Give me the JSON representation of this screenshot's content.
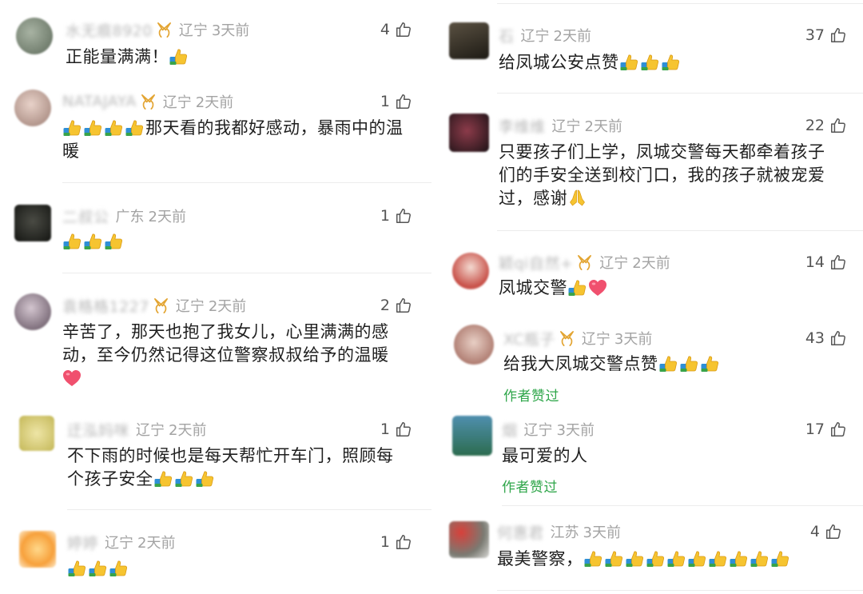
{
  "left": [
    {
      "user": "水无痕8920",
      "medal": true,
      "region": "辽宁",
      "time": "3天前",
      "likes": "4",
      "text": "正能量满满！",
      "emoji_after": 1,
      "avatar": "#7c8a78"
    },
    {
      "user": "NATAJAYA",
      "medal": true,
      "region": "辽宁",
      "time": "2天前",
      "likes": "1",
      "emoji_before": 4,
      "text_line1": "那天看的我都好感动，暴雨中的温",
      "text_line2": "暖",
      "avatar": "#b59a92"
    },
    {
      "user": "二叔公",
      "medal": false,
      "region": "广东",
      "time": "2天前",
      "likes": "1",
      "emoji_only": 3,
      "avatar": "#2e2f2a"
    },
    {
      "user": "袁格格1227",
      "medal": true,
      "region": "辽宁",
      "time": "2天前",
      "likes": "2",
      "text_line1": "辛苦了，那天也抱了我女儿，心里满满的感",
      "text_line2": "动，至今仍然记得这位警察叔叔给予的温暖",
      "heart_line3": true,
      "avatar": "#8a7a86"
    },
    {
      "user": "迂泓妈咪",
      "medal": false,
      "region": "辽宁",
      "time": "2天前",
      "likes": "1",
      "text_line1": "不下雨的时候也是每天帮忙开车门，照顾每",
      "text_line2": "个孩子安全",
      "emoji_after_line2": 3,
      "avatar": "#d9cf78"
    },
    {
      "user": "婷婷",
      "medal": false,
      "region": "辽宁",
      "time": "2天前",
      "likes": "1",
      "emoji_only": 3,
      "avatar": "#f4b35a"
    }
  ],
  "right": [
    {
      "user": "石",
      "medal": false,
      "region": "辽宁",
      "time": "2天前",
      "likes": "37",
      "text": "给凤城公安点赞",
      "emoji_after": 3,
      "avatar": "#3a3428"
    },
    {
      "user": "李维维",
      "medal": false,
      "region": "辽宁",
      "time": "2天前",
      "likes": "22",
      "text_line1": "只要孩子们上学，凤城交警每天都牵着孩子",
      "text_line2": "们的手安全送到校门口，我的孩子就被宠爱",
      "text_line3": "过，感谢",
      "pray": true,
      "avatar": "#4a2a30"
    },
    {
      "user": "颖qi自然+",
      "medal": true,
      "region": "辽宁",
      "time": "2天前",
      "likes": "14",
      "text": "凤城交警",
      "emoji_after": 1,
      "heart_after": true,
      "avatar": "#c9776e"
    },
    {
      "user": "XC瓶子",
      "medal": true,
      "region": "辽宁",
      "time": "3天前",
      "likes": "43",
      "text": "给我大凤城交警点赞",
      "emoji_after": 3,
      "author_liked": "作者赞过",
      "avatar": "#a8736a"
    },
    {
      "user": "烟",
      "medal": false,
      "region": "辽宁",
      "time": "3天前",
      "likes": "17",
      "text": "最可爱的人",
      "author_liked": "作者赞过",
      "avatar": "#4f8fae"
    },
    {
      "user": "何惠君",
      "medal": false,
      "region": "江苏",
      "time": "3天前",
      "likes": "4",
      "text": "最美警察，",
      "emoji_after": 10,
      "avatar": "#c23a36"
    }
  ],
  "colors": {
    "username": "#b8b8b8",
    "meta": "#a3a3a3",
    "text": "#1f1f1f",
    "author_liked": "#2fa64a",
    "medal": "#e3a533"
  },
  "icons": {
    "like": "thumbs-up-outline-icon",
    "emoji": "thumbs-up-emoji-icon",
    "heart": "heart-emoji-icon",
    "pray": "folded-hands-emoji-icon",
    "medal": "medal-badge-icon"
  }
}
